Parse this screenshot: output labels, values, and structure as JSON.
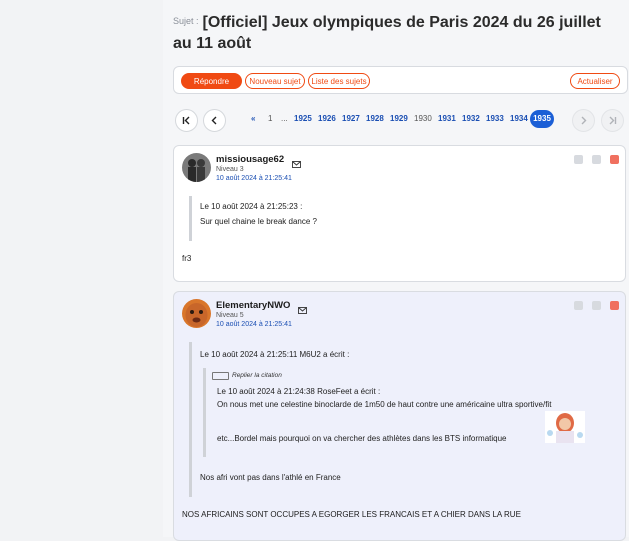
{
  "topic": {
    "sujet_label": "Sujet :",
    "title": "[Officiel] Jeux olympiques de Paris 2024 du 26 juillet au 11 août"
  },
  "actions": {
    "repondre": "Répondre",
    "nouveau_sujet": "Nouveau sujet",
    "liste_sujets": "Liste des sujets",
    "actualiser": "Actualiser"
  },
  "pagination": {
    "prev_arrows": "«",
    "first": "1",
    "ellipsis": "...",
    "pages": [
      "1925",
      "1926",
      "1927",
      "1928",
      "1929",
      "1930",
      "1931",
      "1932",
      "1933",
      "1934"
    ],
    "current": "1935",
    "icons": {
      "first": "first-page-icon",
      "prev": "chevron-left-icon",
      "next": "chevron-right-icon",
      "last": "last-page-icon"
    }
  },
  "posts": [
    {
      "pseudo": "missiousage62",
      "level": "Niveau 3",
      "date": "10 août 2024 à 21:25:41",
      "quote_header": "Le 10 août 2024 à 21:25:23 :",
      "quote_text": "Sur quel chaine le break dance ?",
      "body": "fr3"
    },
    {
      "pseudo": "ElementaryNWO",
      "level": "Niveau 5",
      "date": "10 août 2024 à 21:25:41",
      "quote_header": "Le 10 août 2024 à 21:25:11 M6U2 a écrit :",
      "replier": "Replier la citation",
      "inner_header": "Le 10 août 2024 à 21:24:38 RoseFeet a écrit :",
      "inner_line1": "On nous met une celestine binoclarde de 1m50 de haut contre une américaine ultra sportive/fit",
      "inner_line2": "etc...Bordel mais pourquoi on va chercher des athlètes dans les BTS informatique",
      "quote_after": "Nos afri vont pas dans l'athlé en France",
      "body": "NOS AFRICAINS SONT OCCUPES A EGORGER LES FRANCAIS ET A CHIER DANS LA RUE"
    }
  ]
}
